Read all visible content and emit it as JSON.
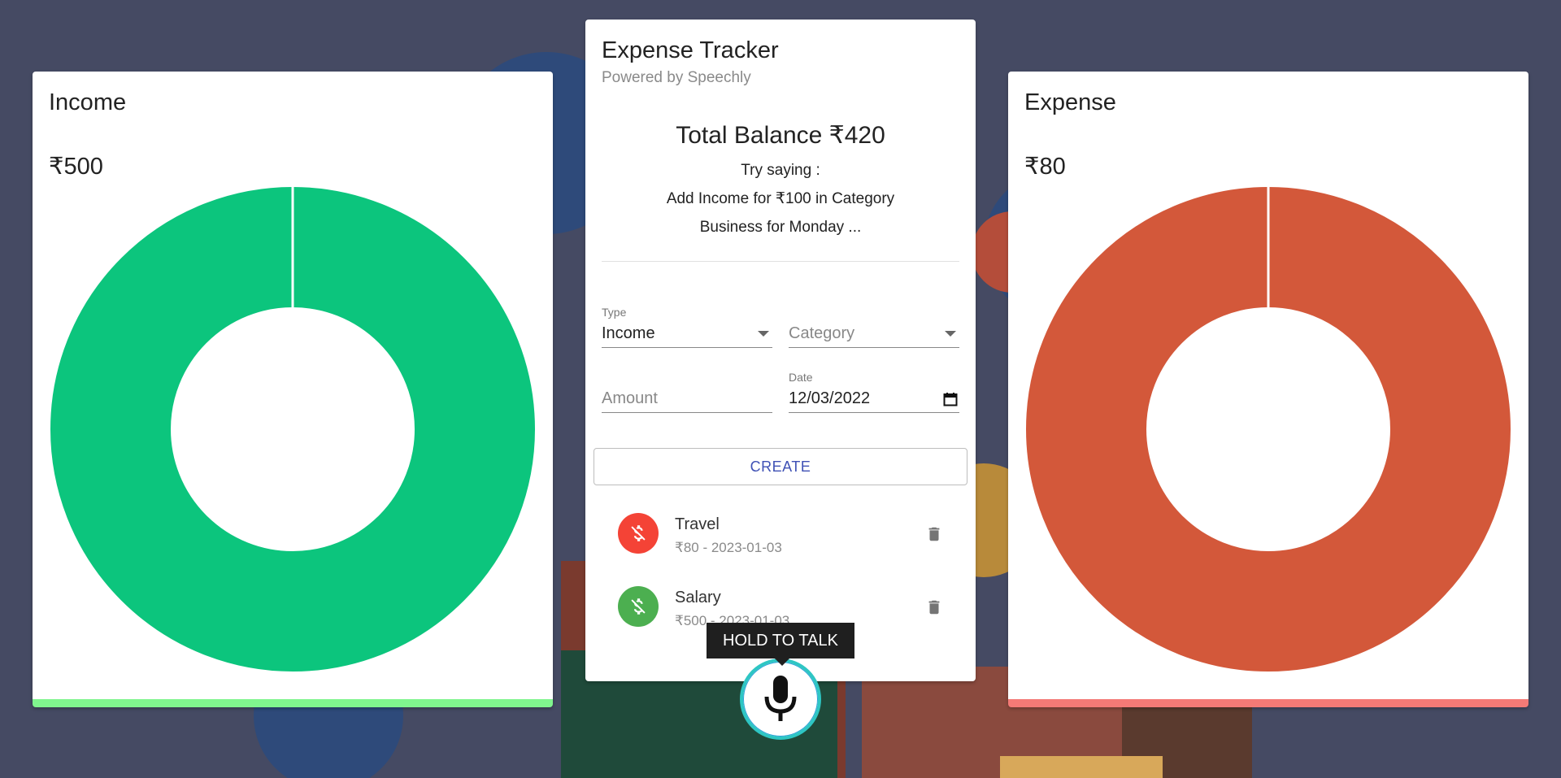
{
  "income_panel": {
    "title": "Income",
    "amount": "₹500",
    "accent_color": "#0cc57d",
    "bar_color": "#80f58e"
  },
  "expense_panel": {
    "title": "Expense",
    "amount": "₹80",
    "accent_color": "#d3583a",
    "bar_color": "#f47a76"
  },
  "main": {
    "title": "Expense Tracker",
    "subtitle": "Powered by Speechly",
    "balance": "Total Balance ₹420",
    "hint_intro": "Try saying :",
    "hint_line1": "Add Income for ₹100 in Category",
    "hint_line2": "Business for Monday ...",
    "form": {
      "type_label": "Type",
      "type_value": "Income",
      "category_placeholder": "Category",
      "amount_placeholder": "Amount",
      "date_label": "Date",
      "date_value": "12/03/2022",
      "create_label": "CREATE"
    },
    "transactions": [
      {
        "name": "Travel",
        "detail": "₹80 - 2023-01-03",
        "kind": "expense",
        "avatar_color": "#f44336"
      },
      {
        "name": "Salary",
        "detail": "₹500 - 2023-01-03",
        "kind": "income",
        "avatar_color": "#4caf50"
      }
    ]
  },
  "voice": {
    "tooltip": "HOLD TO TALK",
    "icon": "microphone-icon"
  },
  "chart_data": [
    {
      "type": "pie",
      "title": "Income",
      "categories": [
        "Salary"
      ],
      "values": [
        500
      ],
      "colors": [
        "#0cc57d"
      ]
    },
    {
      "type": "pie",
      "title": "Expense",
      "categories": [
        "Travel"
      ],
      "values": [
        80
      ],
      "colors": [
        "#d3583a"
      ]
    }
  ]
}
